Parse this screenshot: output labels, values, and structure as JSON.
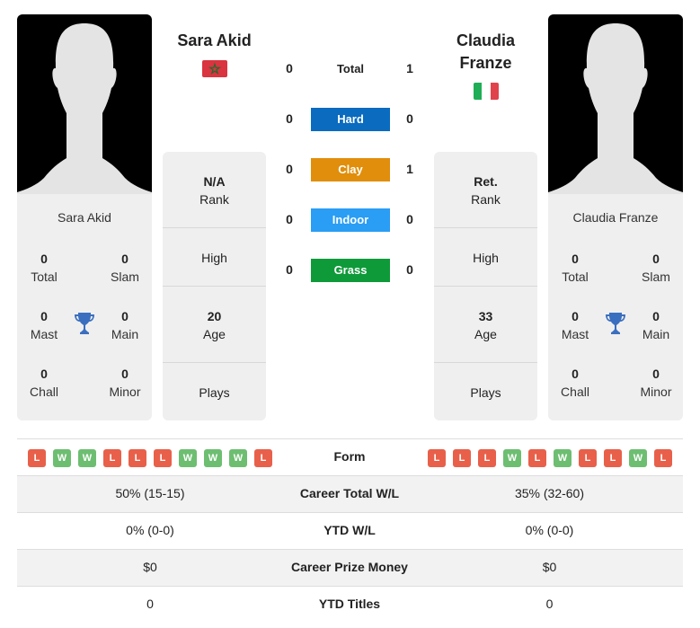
{
  "colors": {
    "hard": "#0a6bbf",
    "clay": "#e08e0b",
    "indoor": "#2a9df4",
    "grass": "#0f9a3a",
    "loss": "#e8604a",
    "win": "#6dbe71",
    "trophy": "#3a6fbf"
  },
  "player1": {
    "name": "Sara Akid",
    "flag": "morocco-flag",
    "titles": {
      "total": {
        "value": "0",
        "label": "Total"
      },
      "slam": {
        "value": "0",
        "label": "Slam"
      },
      "mast": {
        "value": "0",
        "label": "Mast"
      },
      "main": {
        "value": "0",
        "label": "Main"
      },
      "chall": {
        "value": "0",
        "label": "Chall"
      },
      "minor": {
        "value": "0",
        "label": "Minor"
      }
    },
    "info": {
      "rank": {
        "value": "N/A",
        "label": "Rank"
      },
      "high": {
        "label": "High"
      },
      "age": {
        "value": "20",
        "label": "Age"
      },
      "plays": {
        "label": "Plays"
      }
    },
    "form": [
      "L",
      "W",
      "W",
      "L",
      "L",
      "L",
      "W",
      "W",
      "W",
      "L"
    ],
    "career_total_wl": "50% (15-15)",
    "ytd_wl": "0% (0-0)",
    "career_prize": "$0",
    "ytd_titles": "0"
  },
  "player2": {
    "name": "Claudia Franze",
    "name_line1": "Claudia",
    "name_line2": "Franze",
    "flag": "italy-flag",
    "titles": {
      "total": {
        "value": "0",
        "label": "Total"
      },
      "slam": {
        "value": "0",
        "label": "Slam"
      },
      "mast": {
        "value": "0",
        "label": "Mast"
      },
      "main": {
        "value": "0",
        "label": "Main"
      },
      "chall": {
        "value": "0",
        "label": "Chall"
      },
      "minor": {
        "value": "0",
        "label": "Minor"
      }
    },
    "info": {
      "rank": {
        "value": "Ret.",
        "label": "Rank"
      },
      "high": {
        "label": "High"
      },
      "age": {
        "value": "33",
        "label": "Age"
      },
      "plays": {
        "label": "Plays"
      }
    },
    "form": [
      "L",
      "L",
      "L",
      "W",
      "L",
      "W",
      "L",
      "L",
      "W",
      "L"
    ],
    "career_total_wl": "35% (32-60)",
    "ytd_wl": "0% (0-0)",
    "career_prize": "$0",
    "ytd_titles": "0"
  },
  "h2h": [
    {
      "label": "Total",
      "p1": "0",
      "p2": "1"
    },
    {
      "label": "Hard",
      "p1": "0",
      "p2": "0"
    },
    {
      "label": "Clay",
      "p1": "0",
      "p2": "1"
    },
    {
      "label": "Indoor",
      "p1": "0",
      "p2": "0"
    },
    {
      "label": "Grass",
      "p1": "0",
      "p2": "0"
    }
  ],
  "table_labels": {
    "form": "Form",
    "career_total_wl": "Career Total W/L",
    "ytd_wl": "YTD W/L",
    "career_prize": "Career Prize Money",
    "ytd_titles": "YTD Titles"
  }
}
